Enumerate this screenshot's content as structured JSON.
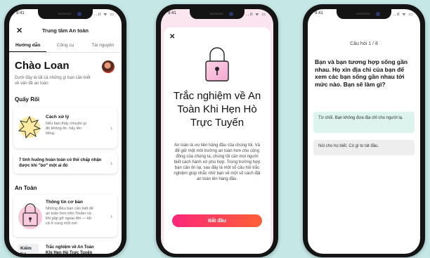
{
  "status": {
    "time": "9:41",
    "icons": "..ıl ᯤ ▭"
  },
  "phone1": {
    "title": "Trung tâm An toàn",
    "tabs": [
      "Hướng dẫn",
      "Công cụ",
      "Tài nguyên"
    ],
    "greeting": "Chào Loan",
    "subtitle": "Dưới đây là tất cả những gì bạn cần biết về vấn đề an toàn",
    "section1": "Quấy Rối",
    "card1": {
      "title": "Cách xử lý",
      "desc": "Nếu bạn thấy chuyện gì đó không ổn, hãy lên tiếng."
    },
    "card2": {
      "title": "7 tình huống hoàn toàn có thể chấp nhận được khi \"bơ\" một ai đó"
    },
    "section2": "An Toàn",
    "card3": {
      "title": "Thông tin cơ bản",
      "desc": "Những điều bạn cần biết để an toàn hơn trên Tinder và khi gặp gỡ ngoại đời — tất cả ở cùng một nơi."
    },
    "card4": {
      "badge": "Kiểm tra",
      "title": "Trắc nghiệm về An Toàn Khi Hẹn Hò Trực Tuyến"
    }
  },
  "phone2": {
    "title": "Trắc nghiệm về An Toàn Khi Hẹn Hò Trực Tuyến",
    "body": "An toàn là ưu tiên hàng đầu của chúng tôi. Và để giữ một môi trường an toàn hơn cho cộng đồng của chúng ta, chúng tôi cần mọi người biết cách hành xử phù hợp. Trong trường hợp bạn cần ôn lại, sau đây là một số câu hỏi trắc nghiệm giúp nhắc nhở bạn về một số cách đặt an toàn lên hàng đầu.",
    "button": "Bắt đầu"
  },
  "phone3": {
    "counter": "Câu hỏi 1 / 8",
    "question": "Bạn và bạn tương hợp sống gần nhau. Họ xin địa chỉ của bạn để xem các bạn sống gần nhau tới mức nào. Bạn sẽ làm gì?",
    "option_a": "Từ chối. Bạn không đưa địa chỉ cho người lạ.",
    "option_b": "Nói cho họ biết. Có gì to tát đâu."
  },
  "colors": {
    "background": "#c5e7e6",
    "accent_start": "#fd267a",
    "accent_end": "#ff6036",
    "option_selected": "#dcf3ee"
  }
}
